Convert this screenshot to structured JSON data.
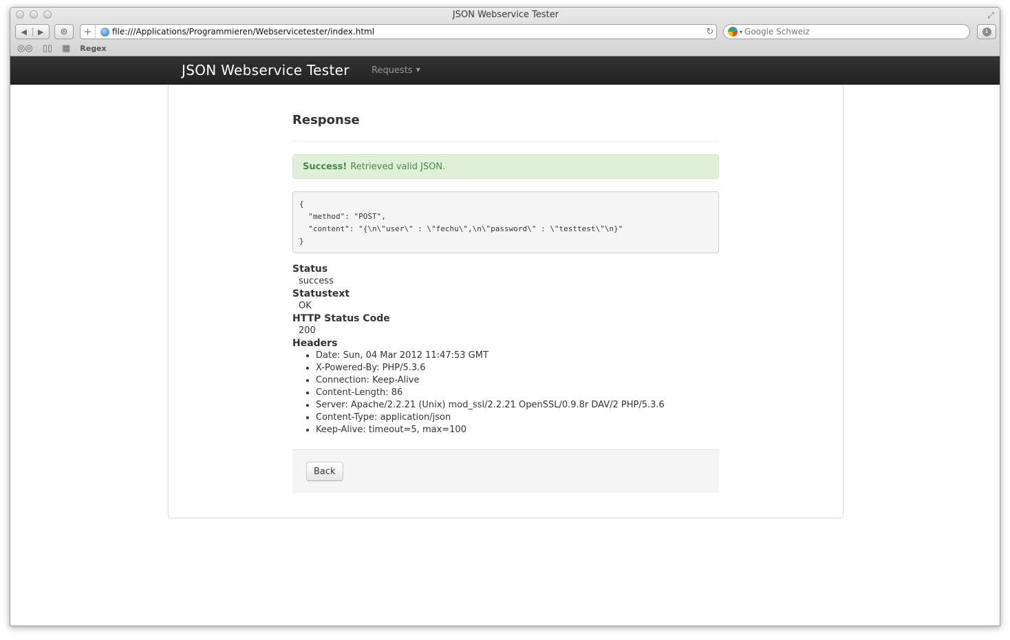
{
  "window": {
    "title": "JSON Webservice Tester"
  },
  "browser": {
    "back_icon": "◀",
    "forward_icon": "▶",
    "url": "file:///Applications/Programmieren/Webservicetester/index.html",
    "search_placeholder": "Google Schweiz",
    "bookmarks": [
      {
        "label": "Regex"
      }
    ]
  },
  "navbar": {
    "brand": "JSON Webservice Tester",
    "menu": [
      {
        "label": "Requests"
      }
    ]
  },
  "page": {
    "title": "Response",
    "alert": {
      "strong": "Success!",
      "text": "Retrieved valid JSON."
    },
    "json_output": "{\n  \"method\": \"POST\",\n  \"content\": \"{\\n\\\"user\\\" : \\\"fechu\\\",\\n\\\"password\\\" : \\\"testtest\\\"\\n}\"\n}",
    "details": {
      "status_label": "Status",
      "status_value": "success",
      "statustext_label": "Statustext",
      "statustext_value": "OK",
      "code_label": "HTTP Status Code",
      "code_value": "200",
      "headers_label": "Headers",
      "headers": [
        "Date: Sun, 04 Mar 2012 11:47:53 GMT",
        "X-Powered-By: PHP/5.3.6",
        "Connection: Keep-Alive",
        "Content-Length: 86",
        "Server: Apache/2.2.21 (Unix) mod_ssl/2.2.21 OpenSSL/0.9.8r DAV/2 PHP/5.3.6",
        "Content-Type: application/json",
        "Keep-Alive: timeout=5, max=100"
      ]
    },
    "back_button": "Back"
  },
  "colors": {
    "navbar": "#222222",
    "alert_bg": "#dff0d8",
    "alert_text": "#468847"
  }
}
